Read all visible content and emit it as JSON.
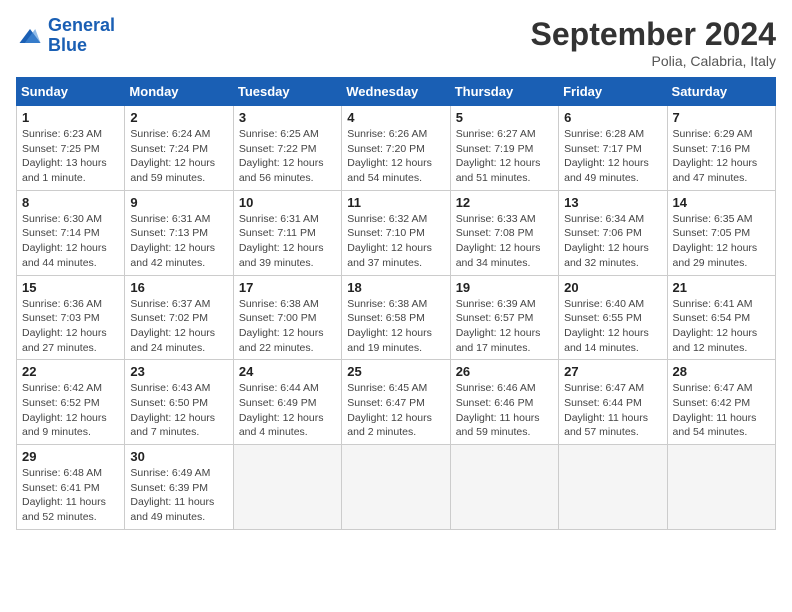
{
  "header": {
    "logo_line1": "General",
    "logo_line2": "Blue",
    "month": "September 2024",
    "location": "Polia, Calabria, Italy"
  },
  "weekdays": [
    "Sunday",
    "Monday",
    "Tuesday",
    "Wednesday",
    "Thursday",
    "Friday",
    "Saturday"
  ],
  "weeks": [
    [
      {
        "day": "1",
        "info": "Sunrise: 6:23 AM\nSunset: 7:25 PM\nDaylight: 13 hours\nand 1 minute."
      },
      {
        "day": "2",
        "info": "Sunrise: 6:24 AM\nSunset: 7:24 PM\nDaylight: 12 hours\nand 59 minutes."
      },
      {
        "day": "3",
        "info": "Sunrise: 6:25 AM\nSunset: 7:22 PM\nDaylight: 12 hours\nand 56 minutes."
      },
      {
        "day": "4",
        "info": "Sunrise: 6:26 AM\nSunset: 7:20 PM\nDaylight: 12 hours\nand 54 minutes."
      },
      {
        "day": "5",
        "info": "Sunrise: 6:27 AM\nSunset: 7:19 PM\nDaylight: 12 hours\nand 51 minutes."
      },
      {
        "day": "6",
        "info": "Sunrise: 6:28 AM\nSunset: 7:17 PM\nDaylight: 12 hours\nand 49 minutes."
      },
      {
        "day": "7",
        "info": "Sunrise: 6:29 AM\nSunset: 7:16 PM\nDaylight: 12 hours\nand 47 minutes."
      }
    ],
    [
      {
        "day": "8",
        "info": "Sunrise: 6:30 AM\nSunset: 7:14 PM\nDaylight: 12 hours\nand 44 minutes."
      },
      {
        "day": "9",
        "info": "Sunrise: 6:31 AM\nSunset: 7:13 PM\nDaylight: 12 hours\nand 42 minutes."
      },
      {
        "day": "10",
        "info": "Sunrise: 6:31 AM\nSunset: 7:11 PM\nDaylight: 12 hours\nand 39 minutes."
      },
      {
        "day": "11",
        "info": "Sunrise: 6:32 AM\nSunset: 7:10 PM\nDaylight: 12 hours\nand 37 minutes."
      },
      {
        "day": "12",
        "info": "Sunrise: 6:33 AM\nSunset: 7:08 PM\nDaylight: 12 hours\nand 34 minutes."
      },
      {
        "day": "13",
        "info": "Sunrise: 6:34 AM\nSunset: 7:06 PM\nDaylight: 12 hours\nand 32 minutes."
      },
      {
        "day": "14",
        "info": "Sunrise: 6:35 AM\nSunset: 7:05 PM\nDaylight: 12 hours\nand 29 minutes."
      }
    ],
    [
      {
        "day": "15",
        "info": "Sunrise: 6:36 AM\nSunset: 7:03 PM\nDaylight: 12 hours\nand 27 minutes."
      },
      {
        "day": "16",
        "info": "Sunrise: 6:37 AM\nSunset: 7:02 PM\nDaylight: 12 hours\nand 24 minutes."
      },
      {
        "day": "17",
        "info": "Sunrise: 6:38 AM\nSunset: 7:00 PM\nDaylight: 12 hours\nand 22 minutes."
      },
      {
        "day": "18",
        "info": "Sunrise: 6:38 AM\nSunset: 6:58 PM\nDaylight: 12 hours\nand 19 minutes."
      },
      {
        "day": "19",
        "info": "Sunrise: 6:39 AM\nSunset: 6:57 PM\nDaylight: 12 hours\nand 17 minutes."
      },
      {
        "day": "20",
        "info": "Sunrise: 6:40 AM\nSunset: 6:55 PM\nDaylight: 12 hours\nand 14 minutes."
      },
      {
        "day": "21",
        "info": "Sunrise: 6:41 AM\nSunset: 6:54 PM\nDaylight: 12 hours\nand 12 minutes."
      }
    ],
    [
      {
        "day": "22",
        "info": "Sunrise: 6:42 AM\nSunset: 6:52 PM\nDaylight: 12 hours\nand 9 minutes."
      },
      {
        "day": "23",
        "info": "Sunrise: 6:43 AM\nSunset: 6:50 PM\nDaylight: 12 hours\nand 7 minutes."
      },
      {
        "day": "24",
        "info": "Sunrise: 6:44 AM\nSunset: 6:49 PM\nDaylight: 12 hours\nand 4 minutes."
      },
      {
        "day": "25",
        "info": "Sunrise: 6:45 AM\nSunset: 6:47 PM\nDaylight: 12 hours\nand 2 minutes."
      },
      {
        "day": "26",
        "info": "Sunrise: 6:46 AM\nSunset: 6:46 PM\nDaylight: 11 hours\nand 59 minutes."
      },
      {
        "day": "27",
        "info": "Sunrise: 6:47 AM\nSunset: 6:44 PM\nDaylight: 11 hours\nand 57 minutes."
      },
      {
        "day": "28",
        "info": "Sunrise: 6:47 AM\nSunset: 6:42 PM\nDaylight: 11 hours\nand 54 minutes."
      }
    ],
    [
      {
        "day": "29",
        "info": "Sunrise: 6:48 AM\nSunset: 6:41 PM\nDaylight: 11 hours\nand 52 minutes."
      },
      {
        "day": "30",
        "info": "Sunrise: 6:49 AM\nSunset: 6:39 PM\nDaylight: 11 hours\nand 49 minutes."
      },
      null,
      null,
      null,
      null,
      null
    ]
  ]
}
